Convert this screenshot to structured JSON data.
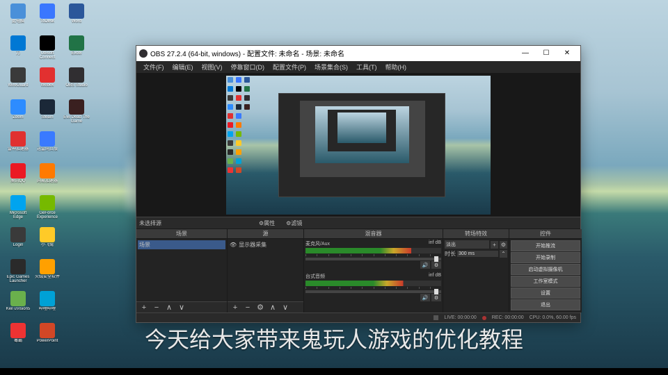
{
  "desktop_icons": [
    {
      "lb": "此电脑",
      "c": "bin"
    },
    {
      "lb": "ToDesk",
      "c": "todesk"
    },
    {
      "lb": "Word",
      "c": "word"
    },
    {
      "lb": "刀",
      "c": "edge"
    },
    {
      "lb": "Ubisoft Connect",
      "c": "ubi"
    },
    {
      "lb": "Excel",
      "c": "excel"
    },
    {
      "lb": "WireGuard",
      "c": "wg"
    },
    {
      "lb": "Webex",
      "c": "webex"
    },
    {
      "lb": "OBS Studio",
      "c": "obs"
    },
    {
      "lb": "Zoom",
      "c": "zoom"
    },
    {
      "lb": "Steam",
      "c": "steam"
    },
    {
      "lb": "Evil Dead The Game",
      "c": "evil"
    },
    {
      "lb": "雷神加速器",
      "c": "lei"
    },
    {
      "lb": "迅雷网页版",
      "c": "thunder"
    },
    {
      "lb": "",
      "c": ""
    },
    {
      "lb": "腾讯QQ",
      "c": "qq"
    },
    {
      "lb": "网易加速器",
      "c": "fire"
    },
    {
      "lb": "",
      "c": ""
    },
    {
      "lb": "Microsoft Edge",
      "c": "mse"
    },
    {
      "lb": "GeForce Experience",
      "c": "gf"
    },
    {
      "lb": "",
      "c": ""
    },
    {
      "lb": "Login",
      "c": "login"
    },
    {
      "lb": "小飞兔",
      "c": "folder"
    },
    {
      "lb": "",
      "c": ""
    },
    {
      "lb": "Epic Games Launcher",
      "c": "epic"
    },
    {
      "lb": "火绒安全软件",
      "c": "huo"
    },
    {
      "lb": "",
      "c": ""
    },
    {
      "lb": "Keil uVision5",
      "c": "keil"
    },
    {
      "lb": "哔哩哔哩",
      "c": "bili"
    },
    {
      "lb": "",
      "c": ""
    },
    {
      "lb": "毒霸",
      "c": "duba"
    },
    {
      "lb": "PowerPoint",
      "c": "ppt"
    },
    {
      "lb": "",
      "c": ""
    }
  ],
  "obs": {
    "title": "OBS 27.2.4 (64-bit, windows) - 配置文件: 未命名 - 场景: 未命名",
    "menu": [
      "文件(F)",
      "编辑(E)",
      "视图(V)",
      "停靠窗口(D)",
      "配置文件(P)",
      "场景集合(S)",
      "工具(T)",
      "帮助(H)"
    ],
    "toolbar": {
      "label": "未选择源",
      "btn1": "属性",
      "btn2": "滤镜"
    },
    "panels": {
      "scenes": {
        "h": "场景",
        "item": "场景"
      },
      "sources": {
        "h": "源",
        "item": "显示器采集"
      },
      "mixer": {
        "h": "混音器",
        "ch1": {
          "name": "麦克风/Aux",
          "val": "inf dB"
        },
        "ch2": {
          "name": "台式音频",
          "val": "inf dB"
        }
      },
      "trans": {
        "h": "转场特效",
        "type": "淡出",
        "dur_lb": "时长",
        "dur": "300 ms"
      },
      "ctrl": {
        "h": "控件",
        "b1": "开始推流",
        "b2": "开始录制",
        "b3": "启动虚拟摄像机",
        "b4": "工作室模式",
        "b5": "设置",
        "b6": "退出"
      }
    },
    "status": {
      "live": "LIVE: 00:00:00",
      "rec": "REC: 00:00:00",
      "cpu": "CPU: 0.0%, 60.00 fps"
    }
  },
  "subtitle": "今天给大家带来鬼玩人游戏的优化教程"
}
